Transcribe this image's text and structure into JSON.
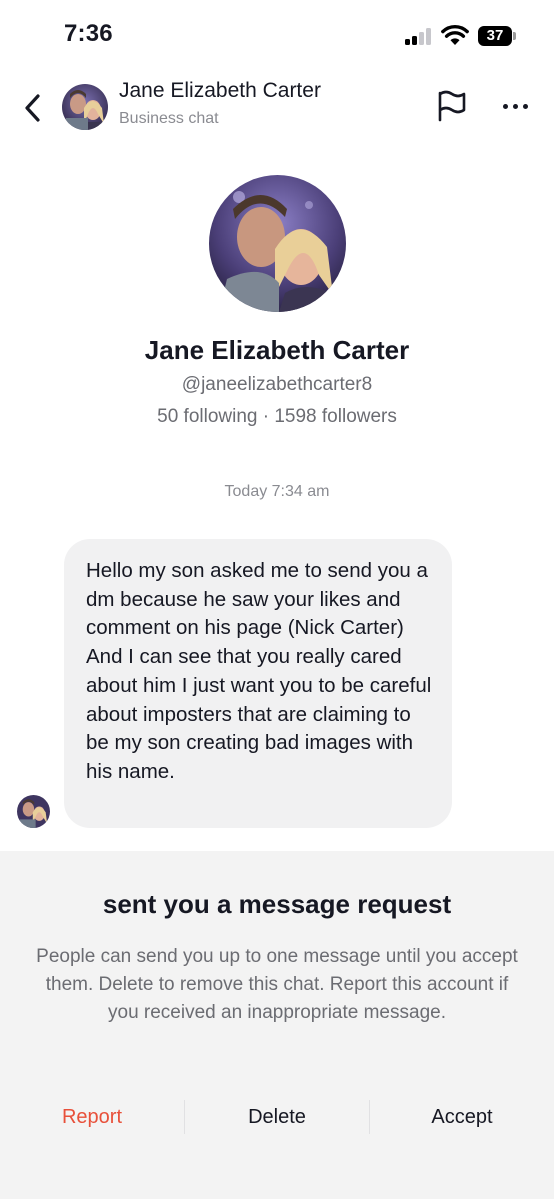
{
  "status_bar": {
    "time": "7:36",
    "battery": "37"
  },
  "header": {
    "back_icon": "chevron-left-icon",
    "name": "Jane Elizabeth Carter",
    "subtitle": "Business chat",
    "flag_icon": "flag-icon",
    "more_icon": "more-horizontal-icon"
  },
  "profile": {
    "name": "Jane Elizabeth Carter",
    "handle": "@janeelizabethcarter8",
    "stats": "50 following · 1598 followers"
  },
  "conversation": {
    "timestamp": "Today 7:34 am",
    "messages": [
      {
        "text": "Hello my son asked me to send you a dm because he saw your likes and comment on his page (Nick Carter) And I can see that you really cared about him I just want you to be careful about imposters that are claiming to be my son creating bad images with his name."
      }
    ]
  },
  "request_sheet": {
    "title": "sent you a message request",
    "body": "People can send you up to one message until you accept them. Delete to remove this chat. Report this account if you received an inappropriate message.",
    "report_label": "Report",
    "delete_label": "Delete",
    "accept_label": "Accept"
  },
  "colors": {
    "report": "#e8503a",
    "text": "#161823",
    "secondary": "#6b6c72",
    "bubble": "#f1f1f2",
    "sheet": "#f3f3f3"
  }
}
